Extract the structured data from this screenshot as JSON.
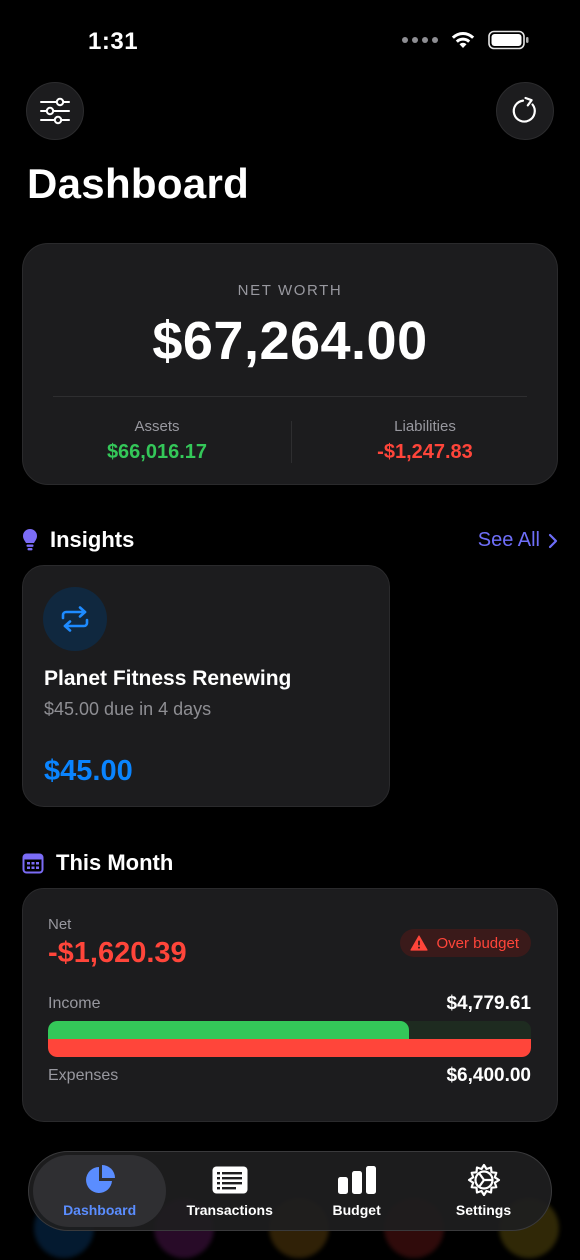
{
  "status_bar": {
    "time": "1:31"
  },
  "header": {
    "title": "Dashboard"
  },
  "net_worth": {
    "label": "NET WORTH",
    "value": "$67,264.00",
    "assets_label": "Assets",
    "assets_value": "$66,016.17",
    "liabilities_label": "Liabilities",
    "liabilities_value": "-$1,247.83"
  },
  "insights": {
    "title": "Insights",
    "see_all": "See All",
    "card": {
      "icon": "repeat-icon",
      "title": "Planet Fitness Renewing",
      "subtitle": "$45.00 due in 4 days",
      "amount": "$45.00"
    }
  },
  "this_month": {
    "title": "This Month",
    "net_label": "Net",
    "net_value": "-$1,620.39",
    "badge": "Over budget",
    "income_label": "Income",
    "income_value": "$4,779.61",
    "expenses_label": "Expenses",
    "expenses_value": "$6,400.00",
    "income_fraction": 0.7468,
    "expenses_fraction": 1.0
  },
  "tab_bar": {
    "tabs": [
      {
        "label": "Dashboard",
        "icon": "pie-chart-icon",
        "active": true
      },
      {
        "label": "Transactions",
        "icon": "list-icon",
        "active": false
      },
      {
        "label": "Budget",
        "icon": "bar-chart-icon",
        "active": false
      },
      {
        "label": "Settings",
        "icon": "gear-icon",
        "active": false
      }
    ]
  },
  "colors": {
    "accent": "#5a8dff",
    "positive": "#34c759",
    "negative": "#ff453a",
    "link": "#6e6ef8",
    "insight_amount": "#0a84ff"
  }
}
